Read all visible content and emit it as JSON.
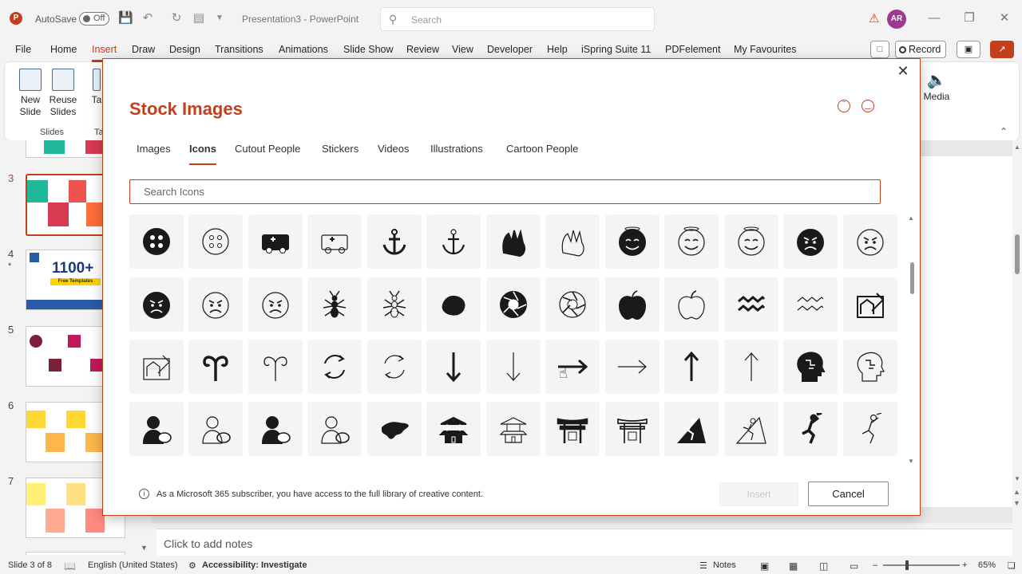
{
  "titlebar": {
    "app_letter": "P",
    "autosave_label": "AutoSave",
    "autosave_state": "Off",
    "doc_title": "Presentation3  -  PowerPoint",
    "search_placeholder": "Search",
    "avatar_initials": "AR",
    "qat_icons": [
      "save-icon",
      "undo-icon",
      "redo-icon",
      "present-from-start-icon",
      "customize-qat-icon"
    ]
  },
  "menu": {
    "items": [
      "File",
      "Home",
      "Insert",
      "Draw",
      "Design",
      "Transitions",
      "Animations",
      "Slide Show",
      "Review",
      "View",
      "Developer",
      "Help",
      "iSpring Suite 11",
      "PDFelement",
      "My Favourites"
    ],
    "active": "Insert",
    "record_label": "Record"
  },
  "ribbon": {
    "new_slide": "New\nSlide",
    "reuse_slides": "Reuse\nSlides",
    "group_slides": "Slides",
    "partial_table": "Ta",
    "partial_group": "Ta",
    "media_label": "Media"
  },
  "thumbs": {
    "slides": [
      {
        "num": "3",
        "active": true
      },
      {
        "num": "4",
        "star": "*",
        "text_big": "1100+",
        "text_small": "Free Templates"
      },
      {
        "num": "5"
      },
      {
        "num": "6"
      },
      {
        "num": "7"
      }
    ]
  },
  "notes": {
    "placeholder": "Click to add notes"
  },
  "status": {
    "slide_info": "Slide 3 of 8",
    "language": "English (United States)",
    "accessibility": "Accessibility: Investigate",
    "notes_label": "Notes",
    "zoom": "65%"
  },
  "dialog": {
    "title": "Stock Images",
    "tabs": [
      "Images",
      "Icons",
      "Cutout People",
      "Stickers",
      "Videos",
      "Illustrations",
      "Cartoon People"
    ],
    "active_tab": "Icons",
    "search_placeholder": "Search Icons",
    "info_text": "As a Microsoft 365 subscriber, you have access to the full library of creative content.",
    "insert_label": "Insert",
    "cancel_label": "Cancel",
    "icons": [
      [
        "button-icon-filled",
        "button-icon-outline",
        "ambulance-icon-filled",
        "ambulance-icon-outline",
        "anchor-icon-filled",
        "anchor-icon-outline",
        "animal-hands-icon-filled",
        "animal-hands-icon-outline",
        "angel-face-icon-filled",
        "angel-face-icon-outline",
        "angel-face-icon-outline-2",
        "angry-face-icon-filled",
        "angry-face-icon-outline"
      ],
      [
        "angry-face-icon-filled-2",
        "angry-face-icon-outline-2",
        "angry-face-icon-outline-3",
        "ant-icon-filled",
        "ant-icon-outline",
        "antarctica-icon-filled",
        "aperture-icon-filled",
        "aperture-icon-outline",
        "apple-icon-filled",
        "apple-icon-outline",
        "aquarius-icon-filled",
        "aquarius-icon-outline",
        "architect-icon-filled"
      ],
      [
        "architect-icon-outline",
        "aries-icon-filled",
        "aries-icon-outline",
        "arrow-circle-icon-filled",
        "arrow-circle-icon-outline",
        "arrow-down-icon-filled",
        "arrow-down-icon-outline",
        "arrow-right-icon-filled",
        "arrow-right-icon-outline",
        "arrow-up-icon-filled",
        "arrow-up-icon-outline",
        "ai-head-icon-filled",
        "ai-head-icon-outline"
      ],
      [
        "painter-woman-icon-filled",
        "painter-woman-icon-outline",
        "painter-man-icon-filled",
        "painter-man-icon-outline",
        "asia-icon-filled",
        "pagoda-icon-filled",
        "pagoda-icon-outline",
        "shrine-gate-icon-filled",
        "shrine-gate-icon-outline",
        "climber-icon-filled",
        "climber-icon-outline",
        "athlete-jump-icon-filled",
        "athlete-jump-icon-outline"
      ]
    ]
  }
}
